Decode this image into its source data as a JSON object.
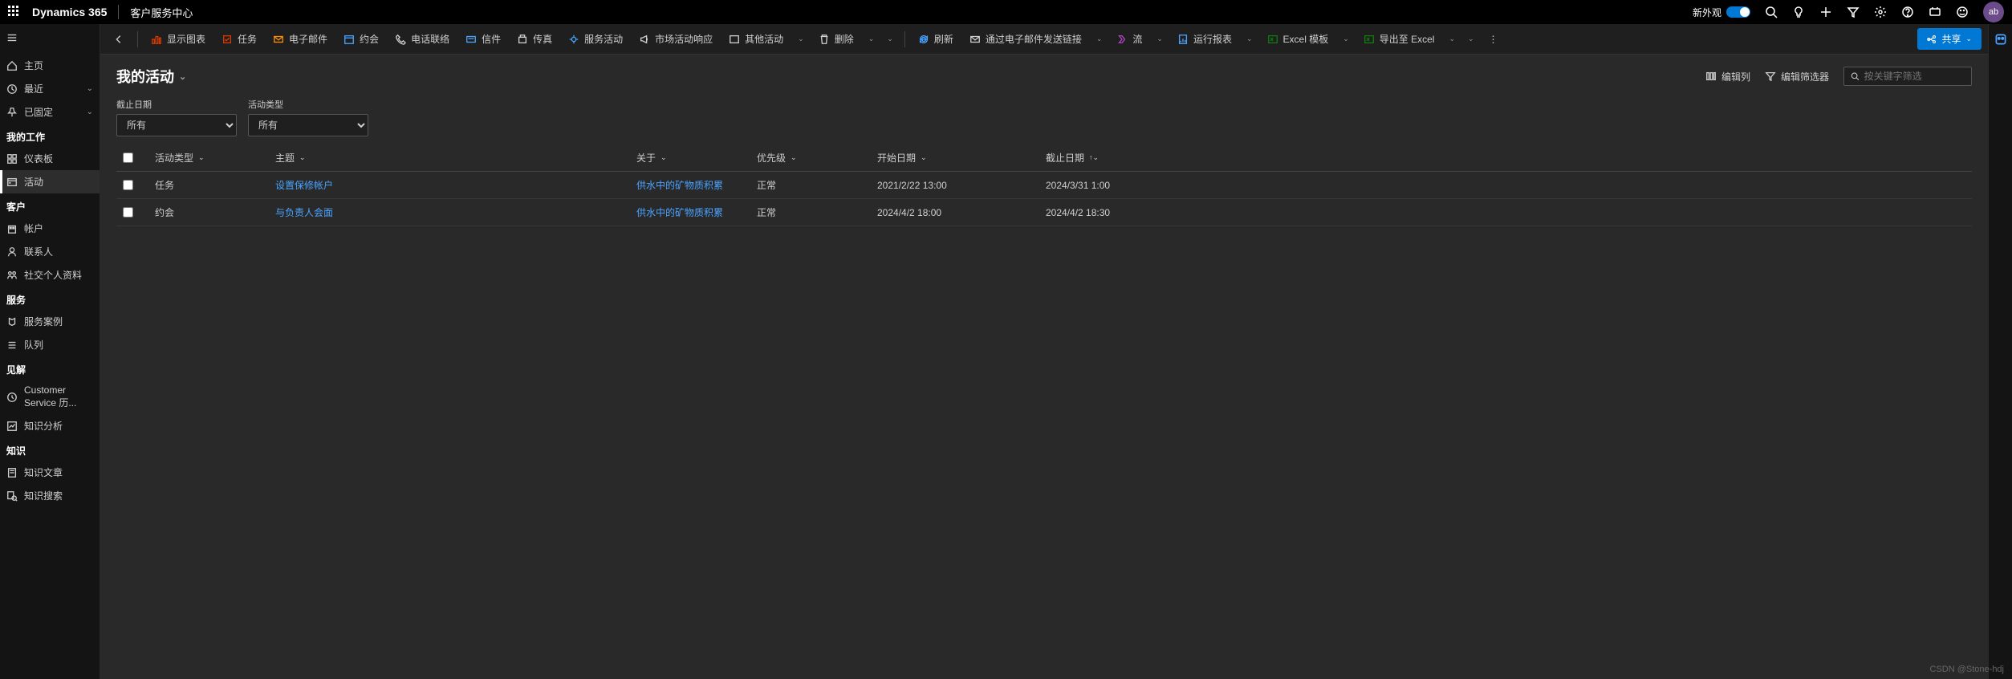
{
  "topbar": {
    "brand": "Dynamics 365",
    "subtitle": "客户服务中心",
    "new_look": "新外观",
    "avatar": "ab"
  },
  "sidebar": {
    "top": [
      {
        "icon": "home",
        "label": "主页"
      },
      {
        "icon": "clock",
        "label": "最近",
        "expandable": true
      },
      {
        "icon": "pin",
        "label": "已固定",
        "expandable": true
      }
    ],
    "groups": [
      {
        "title": "我的工作",
        "items": [
          {
            "icon": "dashboard",
            "label": "仪表板"
          },
          {
            "icon": "activity",
            "label": "活动",
            "active": true
          }
        ]
      },
      {
        "title": "客户",
        "items": [
          {
            "icon": "account",
            "label": "帐户"
          },
          {
            "icon": "contact",
            "label": "联系人"
          },
          {
            "icon": "social",
            "label": "社交个人资料"
          }
        ]
      },
      {
        "title": "服务",
        "items": [
          {
            "icon": "case",
            "label": "服务案例"
          },
          {
            "icon": "queue",
            "label": "队列"
          }
        ]
      },
      {
        "title": "见解",
        "items": [
          {
            "icon": "history",
            "label": "Customer Service 历..."
          },
          {
            "icon": "analytics",
            "label": "知识分析"
          }
        ]
      },
      {
        "title": "知识",
        "items": [
          {
            "icon": "article",
            "label": "知识文章"
          },
          {
            "icon": "ksearch",
            "label": "知识搜索"
          }
        ]
      }
    ]
  },
  "commandbar": {
    "items": [
      {
        "icon": "chart",
        "label": "显示图表",
        "color": "red"
      },
      {
        "icon": "task",
        "label": "任务",
        "color": "red"
      },
      {
        "icon": "email",
        "label": "电子邮件",
        "color": "orange"
      },
      {
        "icon": "appt",
        "label": "约会",
        "color": "blue"
      },
      {
        "icon": "phone",
        "label": "电话联络"
      },
      {
        "icon": "letter",
        "label": "信件",
        "color": "blue"
      },
      {
        "icon": "fax",
        "label": "传真"
      },
      {
        "icon": "svc",
        "label": "服务活动",
        "color": "blue"
      },
      {
        "icon": "campaign",
        "label": "市场活动响应"
      },
      {
        "icon": "other",
        "label": "其他活动",
        "dropdown": true
      },
      {
        "icon": "delete",
        "label": "删除",
        "dropdown": true
      }
    ],
    "right": [
      {
        "icon": "refresh",
        "label": "刷新",
        "color": "blue"
      },
      {
        "icon": "emaillink",
        "label": "通过电子邮件发送链接",
        "dropdown": true
      },
      {
        "icon": "flow",
        "label": "流",
        "color": "purple",
        "dropdown": true
      },
      {
        "icon": "report",
        "label": "运行报表",
        "color": "blue",
        "dropdown": true
      },
      {
        "icon": "excel-tpl",
        "label": "Excel 模板",
        "color": "green",
        "dropdown": true
      },
      {
        "icon": "excel",
        "label": "导出至 Excel",
        "color": "green",
        "dropdown": true
      }
    ],
    "share": "共享"
  },
  "page": {
    "title": "我的活动",
    "edit_cols": "编辑列",
    "edit_filters": "编辑筛选器",
    "search_placeholder": "按关键字筛选",
    "filters": {
      "due_label": "截止日期",
      "due_value": "所有",
      "type_label": "活动类型",
      "type_value": "所有"
    },
    "columns": {
      "type": "活动类型",
      "subject": "主题",
      "about": "关于",
      "priority": "优先级",
      "start": "开始日期",
      "due": "截止日期"
    },
    "rows": [
      {
        "type": "任务",
        "subject": "设置保修帐户",
        "about": "供水中的矿物质积累",
        "priority": "正常",
        "start": "2021/2/22 13:00",
        "due": "2024/3/31 1:00"
      },
      {
        "type": "约会",
        "subject": "与负责人会面",
        "about": "供水中的矿物质积累",
        "priority": "正常",
        "start": "2024/4/2 18:00",
        "due": "2024/4/2 18:30"
      }
    ]
  },
  "watermark": "CSDN @Stone-hdj"
}
